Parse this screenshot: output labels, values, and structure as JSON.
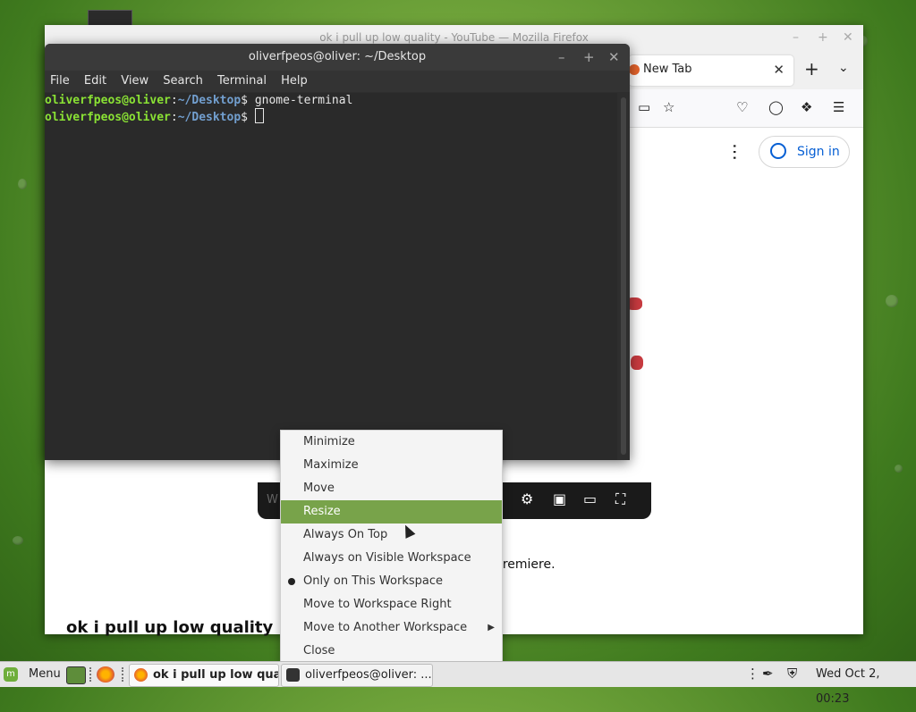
{
  "firefox": {
    "title": "ok i pull up low quality - YouTube — Mozilla Firefox",
    "tab_label": "New Tab",
    "signin_label": "Sign in",
    "video_footer_text": "is Premiere.",
    "video_title": "ok i pull up low quality"
  },
  "terminal": {
    "title": "oliverfpeos@oliver: ~/Desktop",
    "menu": [
      "File",
      "Edit",
      "View",
      "Search",
      "Terminal",
      "Help"
    ],
    "lines": [
      {
        "user": "oliverfpeos@oliver",
        "sep": ":",
        "path": "~/Desktop",
        "prompt": "$ ",
        "cmd": "gnome-terminal"
      },
      {
        "user": "oliverfpeos@oliver",
        "sep": ":",
        "path": "~/Desktop",
        "prompt": "$ ",
        "cmd": ""
      }
    ]
  },
  "context_menu": {
    "items": [
      {
        "label": "Minimize"
      },
      {
        "label": "Maximize"
      },
      {
        "label": "Move"
      },
      {
        "label": "Resize",
        "active": true
      },
      {
        "label": "Always On Top"
      },
      {
        "label": "Always on Visible Workspace"
      },
      {
        "label": "Only on This Workspace",
        "selected": true
      },
      {
        "label": "Move to Workspace Right"
      },
      {
        "label": "Move to Another Workspace",
        "submenu": true
      },
      {
        "label": "Close"
      }
    ]
  },
  "taskbar": {
    "menu_label": "Menu",
    "windows": [
      {
        "label": "ok i pull up low qua...",
        "active": true
      },
      {
        "label": "oliverfpeos@oliver: ...",
        "active": false
      }
    ],
    "clock": "Wed Oct  2, 00:23"
  },
  "colors": {
    "menu_highlight": "#78a34a",
    "prompt_user": "#8ae234",
    "prompt_path": "#729fcf",
    "signin_blue": "#065fd4"
  }
}
